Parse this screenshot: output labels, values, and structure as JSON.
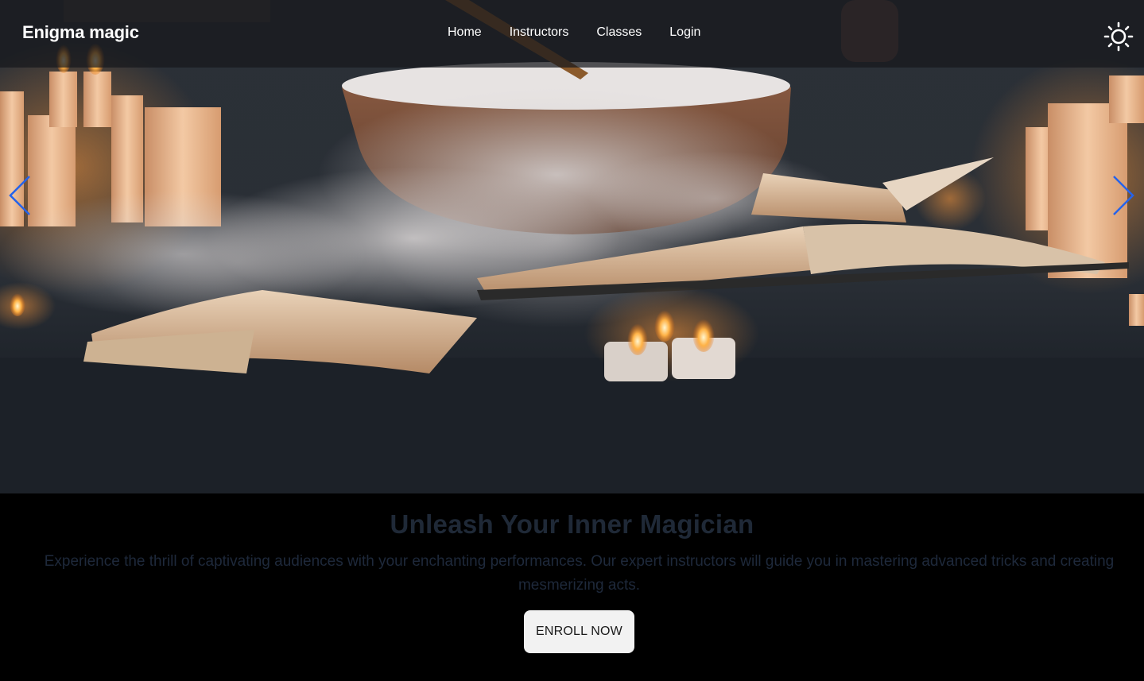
{
  "navbar": {
    "brand": "Enigma magic",
    "links": [
      {
        "label": "Home"
      },
      {
        "label": "Instructors"
      },
      {
        "label": "Classes"
      },
      {
        "label": "Login"
      }
    ],
    "theme_toggle_icon": "sun-icon"
  },
  "carousel": {
    "image_description_icon": "hero-image",
    "prev_icon": "chevron-left-icon",
    "next_icon": "chevron-right-icon",
    "arrow_color": "#2563eb"
  },
  "hero_content": {
    "headline": "Unleash Your Inner Magician",
    "description": "Experience the thrill of captivating audiences with your enchanting performances. Our expert instructors will guide you in mastering advanced tricks and creating mesmerizing acts.",
    "cta_label": "ENROLL NOW"
  },
  "colors": {
    "page_background": "#000000",
    "headline": "#1f2937",
    "description": "#1e293b",
    "button_background": "#f2f2f2",
    "nav_text": "#ffffff"
  }
}
